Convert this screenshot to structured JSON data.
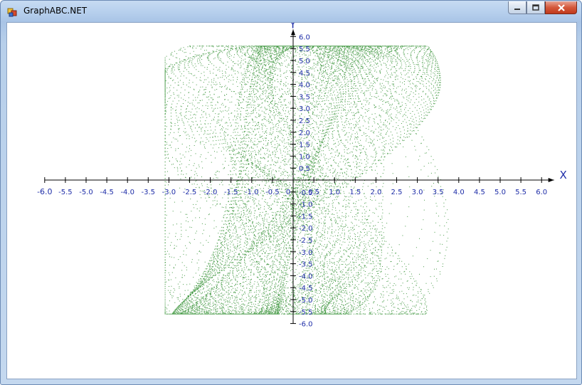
{
  "window": {
    "title": "GraphABC.NET",
    "icon": "graphabc-app-icon",
    "controls": [
      "minimize-icon",
      "maximize-icon",
      "close-icon"
    ]
  },
  "chart_data": {
    "type": "scatter",
    "title": "",
    "xlabel": "X",
    "ylabel": "Y",
    "xlim": [
      -6.0,
      6.0
    ],
    "ylim": [
      -6.0,
      6.0
    ],
    "grid": false,
    "legend": "none",
    "color": "#0a7a0a",
    "axis_color": "#000000",
    "label_color": "#1f2ea8",
    "x_ticks": [
      "-6.0",
      "-5.5",
      "-5.0",
      "-4.5",
      "-4.0",
      "-3.5",
      "-3.0",
      "-2.5",
      "-2.0",
      "-1.5",
      "-1.0",
      "-0.5",
      "0",
      "0.5",
      "1.0",
      "1.5",
      "2.0",
      "2.5",
      "3.0",
      "3.5",
      "4.0",
      "4.5",
      "5.0",
      "5.5",
      "6.0"
    ],
    "y_ticks": [
      "6.0",
      "5.5",
      "5.0",
      "4.5",
      "4.0",
      "3.5",
      "3.0",
      "2.5",
      "2.0",
      "1.5",
      "1.0",
      "0.5",
      "-0.5",
      "-1.0",
      "-1.5",
      "-2.0",
      "-2.5",
      "-3.0",
      "-3.5",
      "-4.0",
      "-4.5",
      "-5.0",
      "-5.5",
      "-6.0"
    ],
    "curve": {
      "x": "3*sin(t)*cos(k*t)+0.8*sin(3t)",
      "y": "5.7*sin(2t+k)",
      "loops": 90
    }
  }
}
